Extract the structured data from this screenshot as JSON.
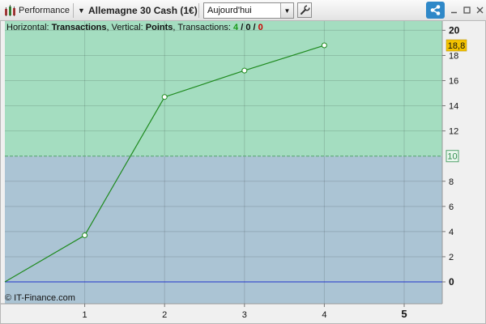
{
  "toolbar": {
    "app_title": "Performance",
    "instrument": "Allemagne 30 Cash (1€)",
    "period": "Aujourd'hui"
  },
  "chart_header": {
    "horizontal_label": "Horizontal: ",
    "horizontal_value": "Transactions",
    "vertical_label": ", Vertical: ",
    "vertical_value": "Points",
    "transactions_label": ", Transactions: ",
    "wins": "4",
    "sep1": " / ",
    "neutral": "0",
    "sep2": " / ",
    "losses": "0"
  },
  "copyright": "© IT-Finance.com",
  "colors": {
    "gain_zone": "#a4ddc0",
    "loss_zone": "#abc4d4",
    "line": "#1e8a1e",
    "zero_line": "#2233cc",
    "current_badge": "#f3c200",
    "share": "#2f88c8",
    "wins": "#1a9a1a",
    "losses": "#cc0000"
  },
  "chart_data": {
    "type": "line",
    "x": [
      0,
      1,
      2,
      3,
      4
    ],
    "y": [
      0,
      3.7,
      14.7,
      16.8,
      18.8
    ],
    "xlim": [
      0,
      5.5
    ],
    "ylim": [
      -2,
      21.5
    ],
    "x_ticks": [
      1,
      2,
      3,
      4,
      5
    ],
    "y_ticks": [
      0,
      2,
      4,
      6,
      8,
      10,
      12,
      14,
      16,
      18,
      20
    ],
    "xlabel": "",
    "ylabel": "",
    "reference_level": 10,
    "reference_label": "10",
    "last_value_label": "18,8",
    "grid": true
  }
}
